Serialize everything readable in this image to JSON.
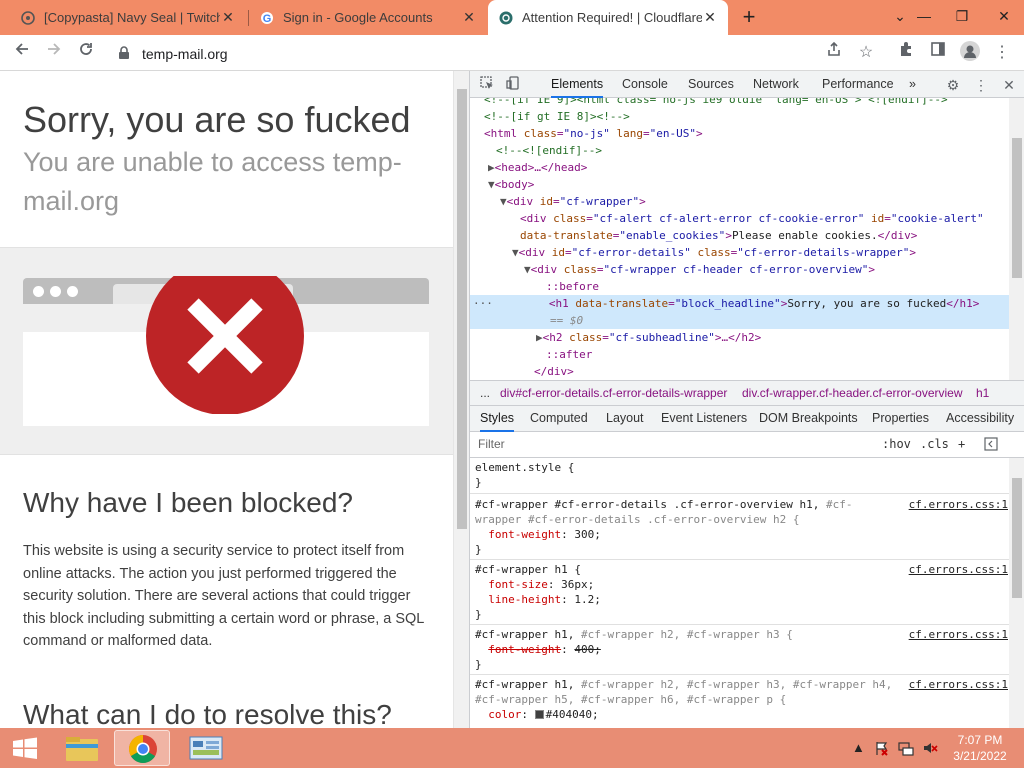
{
  "browser": {
    "tabs": [
      {
        "title": "[Copypasta] Navy Seal | TwitchQu",
        "favicon": "twitch-quotes-icon",
        "active": false
      },
      {
        "title": "Sign in - Google Accounts",
        "favicon": "google-icon",
        "active": false
      },
      {
        "title": "Attention Required! | Cloudflare",
        "favicon": "cloudflare-icon",
        "active": true
      }
    ],
    "new_tab_label": "+",
    "url": "temp-mail.org",
    "accent_color": "#f28b66"
  },
  "page": {
    "headline": "Sorry, you are so fucked",
    "subheadline": "You are unable to access temp-mail.org",
    "why_title": "Why have I been blocked?",
    "why_text": "This website is using a security service to protect itself from online attacks. The action you just performed triggered the security solution. There are several actions that could trigger this block including submitting a certain word or phrase, a SQL command or malformed data.",
    "resolve_title": "What can I do to resolve this?",
    "error_color": "#bd2426"
  },
  "devtools": {
    "tabs": [
      "Elements",
      "Console",
      "Sources",
      "Network",
      "Performance"
    ],
    "more_tabs": "»",
    "dom": {
      "l0": "<!--[if IE 9]><html class=\"no-js ie9 oldie\" lang=\"en-US\"> <![endif]-->",
      "l1": "<!--[if gt IE 8]><!-->",
      "l2_tag": "html",
      "l2_attr1": "class",
      "l2_val1": "\"no-js\"",
      "l2_attr2": "lang",
      "l2_val2": "\"en-US\"",
      "l3": "<!--<![endif]-->",
      "l4": "<head>…</head>",
      "l5": "<body>",
      "l6_val": "\"cf-wrapper\"",
      "l7_val1": "\"cf-alert cf-alert-error cf-cookie-error\"",
      "l7_val2": "\"cookie-alert\"",
      "l8_attr": "data-translate",
      "l8_val": "\"enable_cookies\"",
      "l8_text": "Please enable cookies.",
      "l9_val1": "\"cf-error-details\"",
      "l9_val2": "\"cf-error-details-wrapper\"",
      "l10_val": "\"cf-wrapper cf-header cf-error-overview\"",
      "before": "::before",
      "sel_attr": "data-translate",
      "sel_val": "\"block_headline\"",
      "sel_text": "Sorry, you are so fucked",
      "sel_ref": "== $0",
      "h2_val": "\"cf-subheadline\"",
      "after": "::after",
      "div_close": "</div>",
      "ellipsis": "···"
    },
    "breadcrumbs": [
      "...",
      "div#cf-error-details.cf-error-details-wrapper",
      "div.cf-wrapper.cf-header.cf-error-overview",
      "h1"
    ],
    "style_tabs": [
      "Styles",
      "Computed",
      "Layout",
      "Event Listeners",
      "DOM Breakpoints",
      "Properties",
      "Accessibility"
    ],
    "filter_placeholder": "Filter",
    "hov": ":hov",
    "cls": ".cls",
    "rules": {
      "r0_sel": "element.style {",
      "r0_close": "}",
      "r1_sel_a": "#cf-wrapper #cf-error-details .cf-error-overview h1, ",
      "r1_sel_b": "#cf-",
      "r1_sel_c": "wrapper #cf-error-details .cf-error-overview h2 {",
      "r1_prop": "font-weight",
      "r1_val": "300;",
      "r2_sel": "#cf-wrapper h1 {",
      "r2_prop1": "font-size",
      "r2_val1": "36px;",
      "r2_prop2": "line-height",
      "r2_val2": "1.2;",
      "r3_sel_a": "#cf-wrapper h1, ",
      "r3_sel_b": "#cf-wrapper h2, #cf-wrapper h3 {",
      "r3_prop": "font-weight",
      "r3_val": "400;",
      "r4_sel_a": "#cf-wrapper h1, ",
      "r4_sel_b": "#cf-wrapper h2, #cf-wrapper h3, #cf-wrapper h4,",
      "r4_sel_c": "#cf-wrapper h5, #cf-wrapper h6, #cf-wrapper p {",
      "r4_prop": "color",
      "r4_val": "#404040;",
      "source": "cf.errors.css:1"
    }
  },
  "taskbar": {
    "time": "7:07 PM",
    "date": "3/21/2022"
  }
}
